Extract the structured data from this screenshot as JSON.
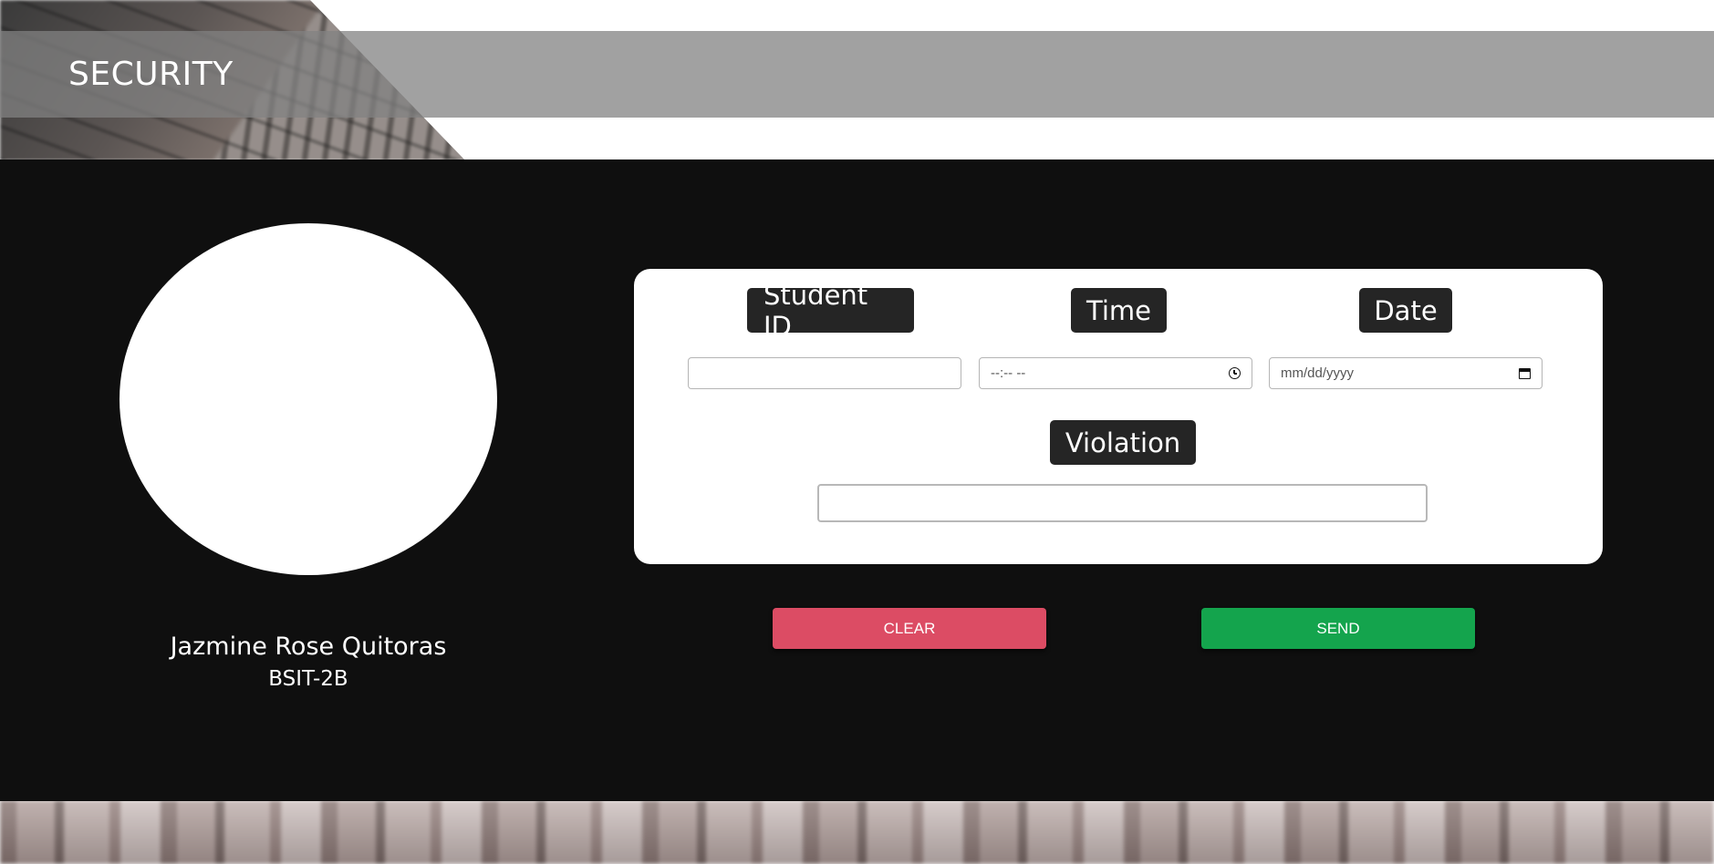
{
  "header": {
    "title": "SECURITY"
  },
  "profile": {
    "name": "Jazmine Rose Quitoras",
    "section": "BSIT-2B"
  },
  "form": {
    "student_id": {
      "label": "Student ID",
      "value": ""
    },
    "time": {
      "label": "Time",
      "placeholder": "--:-- --",
      "icon": "clock-icon"
    },
    "date": {
      "label": "Date",
      "placeholder": "mm/dd/yyyy",
      "icon": "calendar-icon"
    },
    "violation": {
      "label": "Violation",
      "value": ""
    }
  },
  "actions": {
    "clear_label": "CLEAR",
    "send_label": "SEND"
  },
  "colors": {
    "panel_background": "#0f0f0f",
    "label_background": "#252525",
    "clear_button": "#dc4c64",
    "send_button": "#14a44d",
    "header_bar": "#828282"
  }
}
